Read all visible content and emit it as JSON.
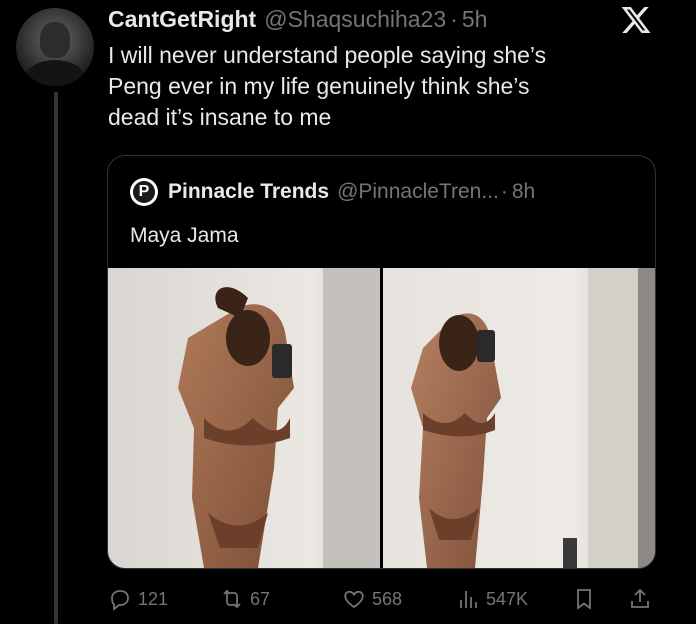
{
  "tweet": {
    "author_name": "CantGetRight",
    "author_handle": "@Shaqsuchiha23",
    "separator": "·",
    "time": "5h",
    "text_lines": [
      "I will never understand people saying she’s",
      "Peng ever in my life genuinely think she’s",
      "dead it’s insane to me"
    ]
  },
  "quote": {
    "author_name": "Pinnacle Trends",
    "author_handle": "@PinnacleTren...",
    "separator": "·",
    "time": "8h",
    "avatar_letter": "P",
    "text": "Maya Jama"
  },
  "actions": {
    "replies": "121",
    "reposts": "67",
    "likes": "568",
    "views": "547K"
  },
  "icons": {
    "brand": "x-logo-icon",
    "reply": "reply-icon",
    "repost": "repost-icon",
    "like": "heart-icon",
    "views": "views-icon",
    "bookmark": "bookmark-icon",
    "share": "share-icon"
  },
  "colors": {
    "background": "#000000",
    "text_primary": "#e7e9ea",
    "text_secondary": "#71767b",
    "border": "#2f3336"
  }
}
